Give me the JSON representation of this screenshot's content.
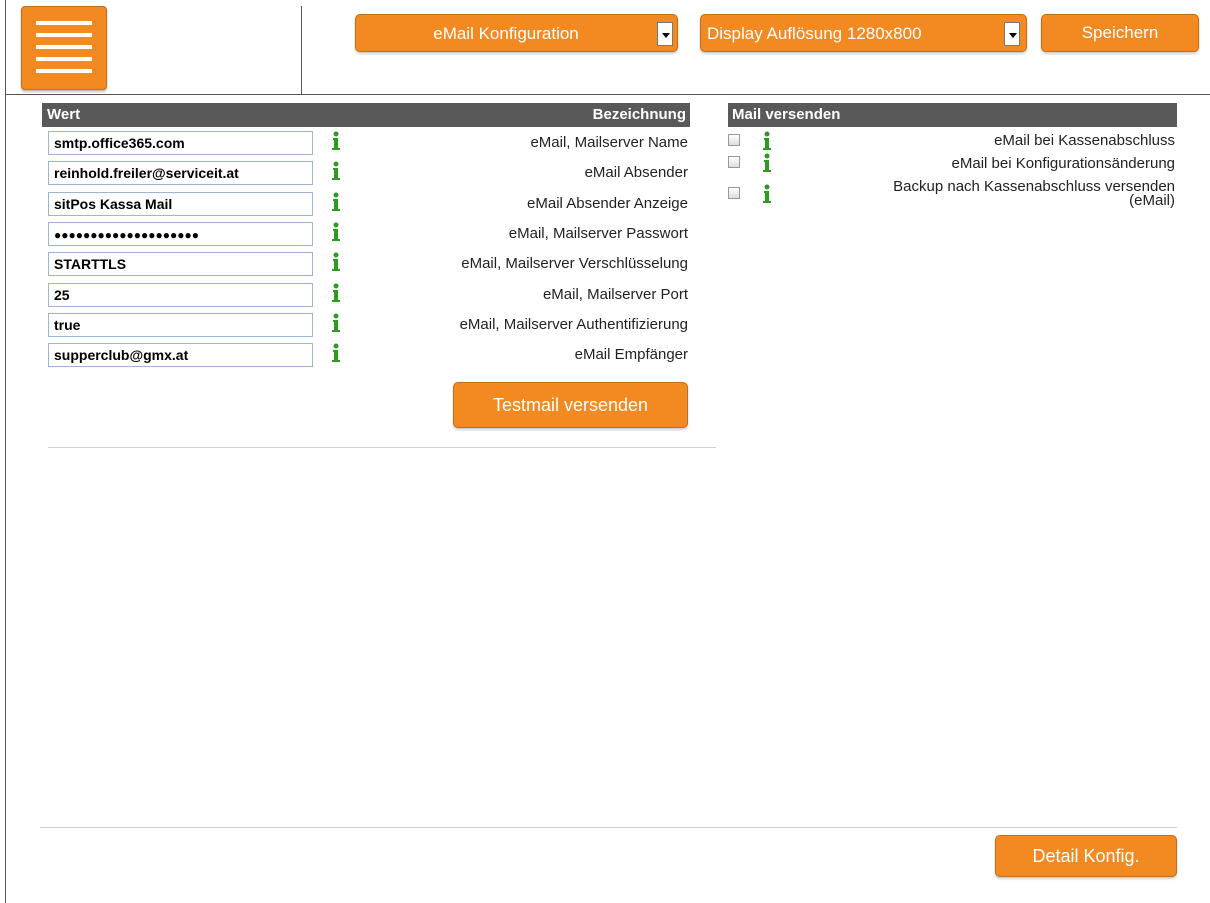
{
  "header": {
    "config_select": "eMail Konfiguration",
    "display_select": "Display Auflösung 1280x800",
    "save_label": "Speichern"
  },
  "email_table": {
    "col_value": "Wert",
    "col_label": "Bezeichnung",
    "rows": [
      {
        "value": "smtp.office365.com",
        "label": "eMail, Mailserver Name"
      },
      {
        "value": "reinhold.freiler@serviceit.at",
        "label": "eMail Absender"
      },
      {
        "value": "sitPos Kassa Mail",
        "label": "eMail Absender Anzeige"
      },
      {
        "value": "●●●●●●●●●●●●●●●●●●●●",
        "label": "eMail, Mailserver Passwort"
      },
      {
        "value": "STARTTLS",
        "label": "eMail, Mailserver Verschlüsselung"
      },
      {
        "value": "25",
        "label": "eMail, Mailserver Port"
      },
      {
        "value": "true",
        "label": "eMail, Mailserver Authentifizierung"
      },
      {
        "value": "supperclub@gmx.at",
        "label": "eMail Empfänger"
      }
    ],
    "test_button": "Testmail versenden"
  },
  "mail_section": {
    "title": "Mail versenden",
    "items": [
      {
        "label": "eMail bei Kassenabschluss",
        "checked": false
      },
      {
        "label": "eMail bei Konfigurationsänderung",
        "checked": false
      },
      {
        "label_line1": "Backup nach Kassenabschluss versenden",
        "label_line2": "(eMail)",
        "checked": false
      }
    ]
  },
  "footer": {
    "detail_button": "Detail Konfig."
  },
  "icons": {
    "menu": "hamburger-menu-icon",
    "info": "info-icon",
    "dropdown": "chevron-down-icon"
  },
  "colors": {
    "accent": "#f28a21",
    "table_header": "#595959",
    "info_green": "#2a9d1e"
  }
}
